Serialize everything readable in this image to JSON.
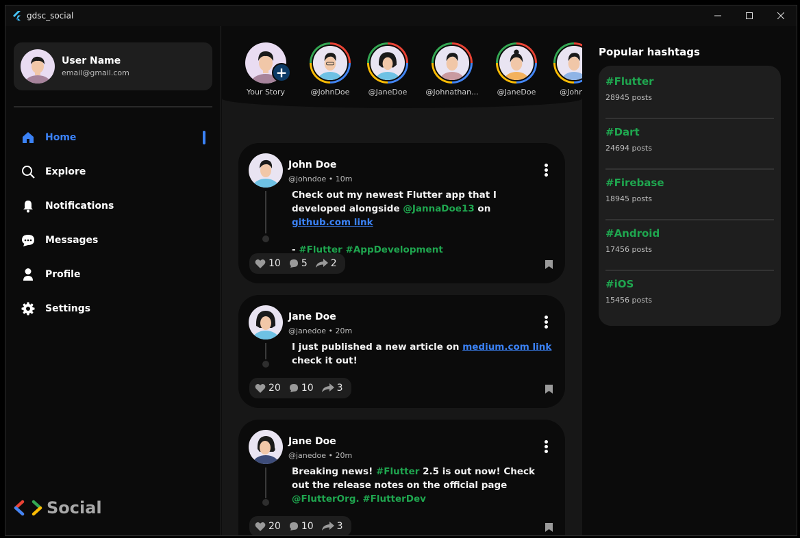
{
  "window": {
    "title": "gdsc_social"
  },
  "user": {
    "name": "User Name",
    "email": "email@gmail.com"
  },
  "nav": [
    {
      "label": "Home",
      "icon": "home-icon",
      "active": true
    },
    {
      "label": "Explore",
      "icon": "search-icon",
      "active": false
    },
    {
      "label": "Notifications",
      "icon": "bell-icon",
      "active": false
    },
    {
      "label": "Messages",
      "icon": "chat-bubble-icon",
      "active": false
    },
    {
      "label": "Profile",
      "icon": "person-icon",
      "active": false
    },
    {
      "label": "Settings",
      "icon": "gear-icon",
      "active": false
    }
  ],
  "brand": {
    "text": "Social"
  },
  "stories": [
    {
      "label": "Your Story",
      "own": true
    },
    {
      "label": "@JohnDoe"
    },
    {
      "label": "@JaneDoe"
    },
    {
      "label": "@Johnathan..."
    },
    {
      "label": "@JaneDoe"
    },
    {
      "label": "@Johna"
    }
  ],
  "posts": [
    {
      "name": "John Doe",
      "meta": "@johndoe • 10m",
      "body": [
        [
          {
            "t": "text",
            "v": "Check out my newest Flutter app that I developed alongside "
          },
          {
            "t": "mention",
            "v": "@JannaDoe13"
          },
          {
            "t": "text",
            "v": " on "
          },
          {
            "t": "link",
            "v": "github.com link"
          }
        ],
        [],
        [
          {
            "t": "text",
            "v": "- "
          },
          {
            "t": "tag",
            "v": "#Flutter"
          },
          {
            "t": "text",
            "v": " "
          },
          {
            "t": "tag",
            "v": "#AppDevelopment"
          }
        ]
      ],
      "likes": "10",
      "comments": "5",
      "shares": "2"
    },
    {
      "name": "Jane Doe",
      "meta": "@janedoe • 20m",
      "body": [
        [
          {
            "t": "text",
            "v": "I just published a new article on "
          },
          {
            "t": "link",
            "v": "medium.com link"
          },
          {
            "t": "text",
            "v": " check it out!"
          }
        ]
      ],
      "likes": "20",
      "comments": "10",
      "shares": "3"
    },
    {
      "name": "Jane Doe",
      "meta": "@janedoe • 20m",
      "body": [
        [
          {
            "t": "text",
            "v": "Breaking news! "
          },
          {
            "t": "tag",
            "v": "#Flutter"
          },
          {
            "t": "text",
            "v": " 2.5 is out now! Check out the release notes on the official page "
          },
          {
            "t": "mention",
            "v": "@FlutterOrg."
          },
          {
            "t": "text",
            "v": " "
          },
          {
            "t": "tag",
            "v": "#FlutterDev"
          }
        ]
      ],
      "likes": "20",
      "comments": "10",
      "shares": "3"
    }
  ],
  "hashtags": {
    "title": "Popular hashtags",
    "items": [
      {
        "tag": "#Flutter",
        "count": "28945 posts"
      },
      {
        "tag": "#Dart",
        "count": "24694 posts"
      },
      {
        "tag": "#Firebase",
        "count": "18945 posts"
      },
      {
        "tag": "#Android",
        "count": "17456 posts"
      },
      {
        "tag": "#iOS",
        "count": "15456 posts"
      }
    ]
  },
  "colors": {
    "accent": "#3b82f6",
    "tag": "#1fa64f",
    "background": "#0b0b0b",
    "card": "#1e1e1e"
  }
}
